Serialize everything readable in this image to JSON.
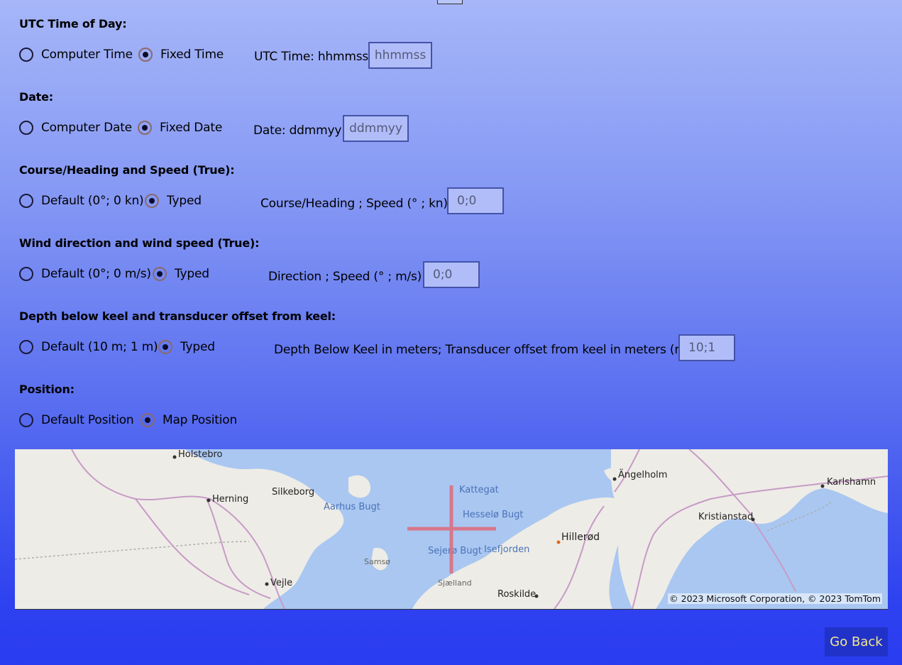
{
  "utc": {
    "heading": "UTC Time of Day:",
    "option_computer": "Computer Time",
    "option_fixed": "Fixed Time",
    "field_label": "UTC Time: hhmmss",
    "field_placeholder": "hhmmss",
    "selected": "fixed"
  },
  "date": {
    "heading": "Date:",
    "option_computer": "Computer Date",
    "option_fixed": "Fixed Date",
    "field_label": "Date: ddmmyy",
    "field_placeholder": "ddmmyy",
    "selected": "fixed"
  },
  "course": {
    "heading": "Course/Heading and Speed (True):",
    "option_default": "Default (0°; 0 kn)",
    "option_typed": "Typed",
    "field_label": "Course/Heading ; Speed  (° ; kn):",
    "field_value": "0;0",
    "selected": "typed"
  },
  "wind": {
    "heading": "Wind direction and wind speed (True):",
    "option_default": "Default (0°; 0 m/s)",
    "option_typed": "Typed",
    "field_label": "Direction ; Speed  (° ; m/s):",
    "field_value": "0;0",
    "selected": "typed"
  },
  "depth": {
    "heading": "Depth below keel and transducer offset from keel:",
    "option_default": "Default (10 m; 1 m)",
    "option_typed": "Typed",
    "field_label": "Depth Below Keel in meters; Transducer offset from keel in meters (m;m)",
    "field_value": "10;1",
    "selected": "typed"
  },
  "position": {
    "heading": "Position:",
    "option_default": "Default Position",
    "option_map": "Map Position",
    "selected": "map"
  },
  "map": {
    "labels": {
      "holstebro": "Holstebro",
      "herning": "Herning",
      "silkeborg": "Silkeborg",
      "aarhus_bugt": "Aarhus Bugt",
      "kattegat": "Kattegat",
      "hesselo_bugt": "Hesselø Bugt",
      "angelholm": "Ängelholm",
      "karlshamn": "Karlshamn",
      "kristianstad": "Kristianstad",
      "hillerod": "Hillerød",
      "sejero_bugt": "Sejerø Bugt",
      "isefjorden": "Isefjorden",
      "samso": "Samsø",
      "vejle": "Vejle",
      "sjaelland": "Sjælland",
      "roskilde": "Roskilde"
    },
    "copyright": "© 2023 Microsoft Corporation, © 2023 TomTom",
    "colors": {
      "water": "#a9c7f1",
      "land": "#eeece6",
      "crosshair": "#e06a7a"
    }
  },
  "go_back_label": "Go Back"
}
